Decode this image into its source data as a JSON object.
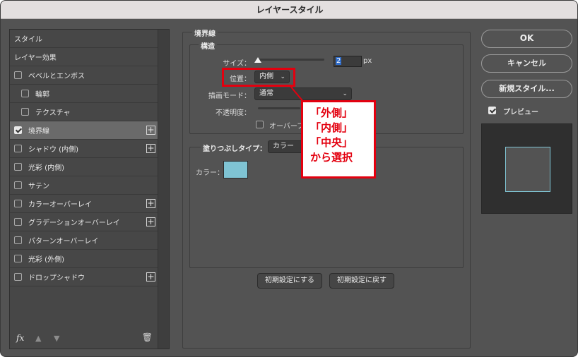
{
  "window": {
    "title": "レイヤースタイル"
  },
  "styles_panel": {
    "header": "スタイル",
    "section": "レイヤー効果",
    "items": [
      {
        "label": "ベベルとエンボス",
        "checked": false,
        "indent": false,
        "plus": false,
        "active": false
      },
      {
        "label": "輪郭",
        "checked": false,
        "indent": true,
        "plus": false,
        "active": false
      },
      {
        "label": "テクスチャ",
        "checked": false,
        "indent": true,
        "plus": false,
        "active": false
      },
      {
        "label": "境界線",
        "checked": true,
        "indent": false,
        "plus": true,
        "active": true
      },
      {
        "label": "シャドウ (内側)",
        "checked": false,
        "indent": false,
        "plus": true,
        "active": false
      },
      {
        "label": "光彩 (内側)",
        "checked": false,
        "indent": false,
        "plus": false,
        "active": false
      },
      {
        "label": "サテン",
        "checked": false,
        "indent": false,
        "plus": false,
        "active": false
      },
      {
        "label": "カラーオーバーレイ",
        "checked": false,
        "indent": false,
        "plus": true,
        "active": false
      },
      {
        "label": "グラデーションオーバーレイ",
        "checked": false,
        "indent": false,
        "plus": true,
        "active": false
      },
      {
        "label": "パターンオーバーレイ",
        "checked": false,
        "indent": false,
        "plus": false,
        "active": false
      },
      {
        "label": "光彩 (外側)",
        "checked": false,
        "indent": false,
        "plus": false,
        "active": false
      },
      {
        "label": "ドロップシャドウ",
        "checked": false,
        "indent": false,
        "plus": true,
        "active": false
      }
    ],
    "footer": {
      "fx": "fx",
      "up_icon": "arrow-up-icon",
      "down_icon": "arrow-down-icon",
      "trash_icon": "trash-icon"
    }
  },
  "stroke": {
    "title": "境界線",
    "structure_title": "構造",
    "size_label": "サイズ：",
    "size_value": "2",
    "size_unit": "px",
    "position_label": "位置：",
    "position_value": "内側",
    "blend_label": "描画モード：",
    "blend_value": "通常",
    "opacity_label": "不透明度：",
    "overprint_label": "オーバープ",
    "fill_type_label": "塗りつぶしタイプ：",
    "fill_type_value": "カラー",
    "color_label": "カラー：",
    "color_hex": "#7fc4d4",
    "reset_default_button": "初期設定にする",
    "restore_default_button": "初期設定に戻す"
  },
  "right_buttons": {
    "ok": "OK",
    "cancel": "キャンセル",
    "new_style": "新規スタイル...",
    "preview_label": "プレビュー",
    "preview_checked": true
  },
  "callout": {
    "lines": [
      "「外側」",
      "「内側」",
      "「中央」",
      "から選択"
    ],
    "color": "#e3000f"
  }
}
